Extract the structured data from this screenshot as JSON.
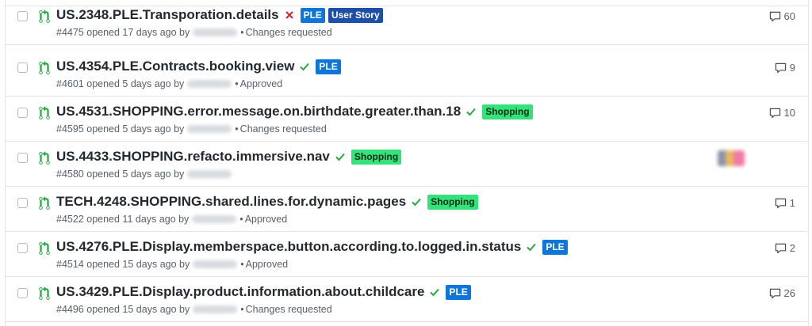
{
  "icons": {
    "pr": "git-pull-request-icon",
    "check": "check-icon",
    "x": "x-icon",
    "comment": "comment-icon"
  },
  "colors": {
    "pr_open": "#28a745",
    "check": "#28a745",
    "fail": "#cb2431",
    "label_ple": "#0e76d8",
    "label_shopping": "#34e27a",
    "label_user_story": "#1d4fa8"
  },
  "pull_requests": [
    {
      "title": "US.4354.PLE.Contracts.booking.view",
      "status": "success",
      "labels": [
        "PLE"
      ],
      "number": "#4601",
      "opened": "opened 5 days ago by",
      "separator": "•",
      "review": "Approved",
      "comments": "9"
    },
    {
      "title": "US.4531.SHOPPING.error.message.on.birthdate.greater.than.18",
      "status": "success",
      "labels": [
        "Shopping"
      ],
      "number": "#4595",
      "opened": "opened 5 days ago by",
      "separator": "•",
      "review": "Changes requested",
      "comments": "10"
    },
    {
      "title": "US.4433.SHOPPING.refacto.immersive.nav",
      "status": "success",
      "labels": [
        "Shopping"
      ],
      "number": "#4580",
      "opened": "opened 5 days ago by",
      "separator": "",
      "review": "",
      "comments": ""
    },
    {
      "title": "TECH.4248.SHOPPING.shared.lines.for.dynamic.pages",
      "status": "success",
      "labels": [
        "Shopping"
      ],
      "number": "#4522",
      "opened": "opened 11 days ago by",
      "separator": "•",
      "review": "Approved",
      "comments": "1"
    },
    {
      "title": "US.4276.PLE.Display.memberspace.button.according.to.logged.in.status",
      "status": "success",
      "labels": [
        "PLE"
      ],
      "number": "#4514",
      "opened": "opened 15 days ago by",
      "separator": "•",
      "review": "Approved",
      "comments": "2"
    },
    {
      "title": "US.3429.PLE.Display.product.information.about.childcare",
      "status": "success",
      "labels": [
        "PLE"
      ],
      "number": "#4496",
      "opened": "opened 15 days ago by",
      "separator": "•",
      "review": "Changes requested",
      "comments": "26"
    },
    {
      "title": "US.2348.PLE.Transporation.details",
      "status": "failure",
      "labels": [
        "PLE",
        "User Story"
      ],
      "number": "#4475",
      "opened": "opened 17 days ago by",
      "separator": "•",
      "review": "Changes requested",
      "comments": "60"
    }
  ]
}
